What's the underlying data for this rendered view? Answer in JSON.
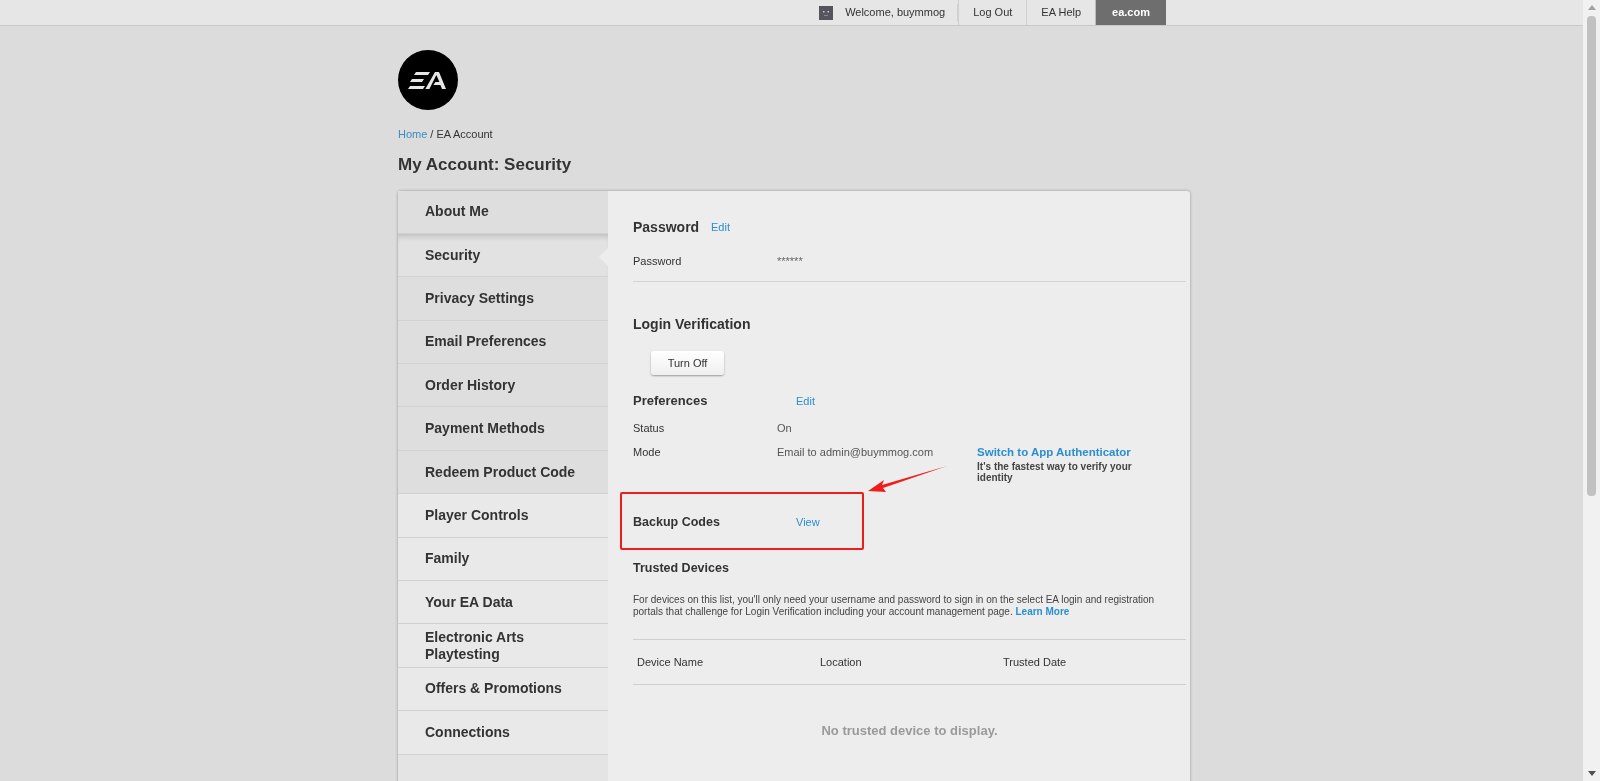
{
  "top_bar": {
    "greeting": "Welcome, buymmog",
    "links": [
      {
        "label": "Log Out",
        "selected": false
      },
      {
        "label": "EA Help",
        "selected": false
      },
      {
        "label": "ea.com",
        "selected": true
      }
    ]
  },
  "breadcrumb": {
    "home": "Home",
    "separator": "/",
    "current": "EA Account"
  },
  "page_title": "My Account: Security",
  "sidebar": {
    "items": [
      {
        "label": "About Me",
        "selected": false
      },
      {
        "label": "Security",
        "selected": true
      },
      {
        "label": "Privacy Settings",
        "selected": false
      },
      {
        "label": "Email Preferences",
        "selected": false
      },
      {
        "label": "Order History",
        "selected": false
      },
      {
        "label": "Payment Methods",
        "selected": false
      },
      {
        "label": "Redeem Product Code",
        "selected": false
      },
      {
        "label": "Player Controls",
        "selected": false
      },
      {
        "label": "Family",
        "selected": false
      },
      {
        "label": "Your EA Data",
        "selected": false
      },
      {
        "label": "Electronic Arts Playtesting",
        "selected": false
      },
      {
        "label": "Offers & Promotions",
        "selected": false
      },
      {
        "label": "Connections",
        "selected": false
      }
    ]
  },
  "password": {
    "heading": "Password",
    "edit": "Edit",
    "label": "Password",
    "value": "******"
  },
  "login_verification": {
    "heading": "Login Verification",
    "button": "Turn Off",
    "preferences": {
      "heading": "Preferences",
      "edit": "Edit"
    },
    "rows": [
      {
        "label": "Status",
        "value": "On"
      },
      {
        "label": "Mode",
        "value": "Email to admin@buymmog.com"
      }
    ],
    "switch_link": "Switch to App Authenticator",
    "switch_hint": "It's the fastest way to verify your identity"
  },
  "backup_codes": {
    "heading": "Backup Codes",
    "link": "View"
  },
  "trusted_devices": {
    "heading": "Trusted Devices",
    "description": "For devices on this list, you'll only need your username and password to sign in on the select EA login and registration portals that challenge for Login Verification including your account management page.",
    "learn_more": "Learn More",
    "columns": [
      "Device Name",
      "Location",
      "Trusted Date"
    ],
    "empty": "No trusted device to display."
  }
}
